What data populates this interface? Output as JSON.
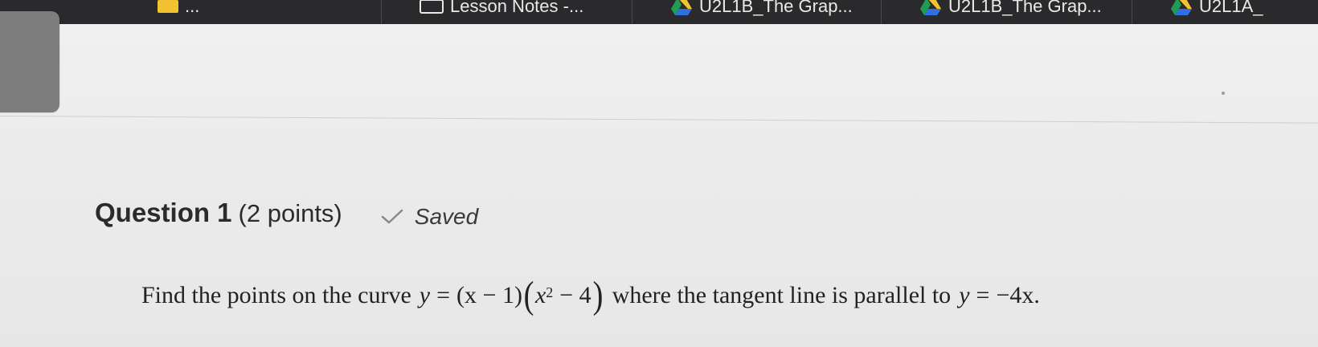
{
  "bookmarks": [
    {
      "label": "...",
      "icon": "folder-icon"
    },
    {
      "label": "Lesson Notes -...",
      "icon": "document-icon"
    },
    {
      "label": "U2L1B_The Grap...",
      "icon": "google-drive-icon"
    },
    {
      "label": "U2L1B_The Grap...",
      "icon": "google-drive-icon"
    },
    {
      "label": "U2L1A_",
      "icon": "google-drive-icon"
    }
  ],
  "question": {
    "title": "Question 1",
    "points": "(2 points)",
    "status": "Saved",
    "text_before": "Find the points on the curve",
    "text_after": "where the tangent line is parallel to",
    "equation_curve": {
      "y": "y",
      "eq": "=",
      "factor1": "(x − 1)",
      "x": "x",
      "exp": "2",
      "minus_four": "− 4"
    },
    "equation_line": {
      "y": "y",
      "eq": "=",
      "rhs": "−4x",
      "period": "."
    }
  },
  "colors": {
    "bookmark_bar": "#2a2a2d",
    "page_bg": "#ececec",
    "grey_block": "#7d7d7d",
    "drive_yellow": "#f3c233",
    "drive_green": "#1f9d55",
    "drive_blue": "#2f6fe0"
  }
}
